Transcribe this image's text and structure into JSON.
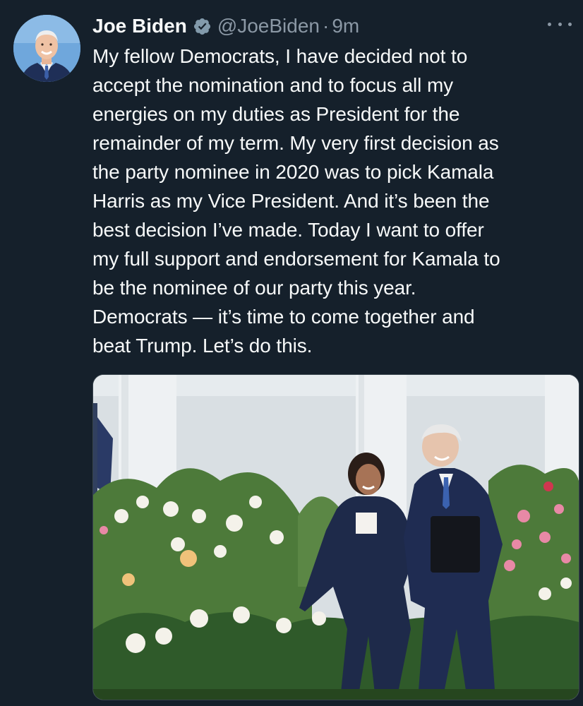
{
  "tweet": {
    "author_name": "Joe Biden",
    "handle": "@JoeBiden",
    "separator": "·",
    "time": "9m",
    "text": "My fellow Democrats, I have decided not to\naccept the nomination and to focus all my\nenergies on my duties as President for the\nremainder of my term. My very first decision as\nthe party nominee in 2020 was to pick Kamala\nHarris as my Vice President. And it’s been the\nbest decision I’ve made. Today I want to offer\nmy full support and endorsement for Kamala to\nbe the nominee of our party this year.\nDemocrats — it’s time to come together and\nbeat Trump. Let’s do this."
  },
  "icons": {
    "verified": "verified-badge-icon",
    "more": "more-options-icon"
  },
  "colors": {
    "background": "#15202b",
    "text_primary": "#f7f9f9",
    "text_secondary": "#8b98a5",
    "verified_badge": "#829aab"
  }
}
